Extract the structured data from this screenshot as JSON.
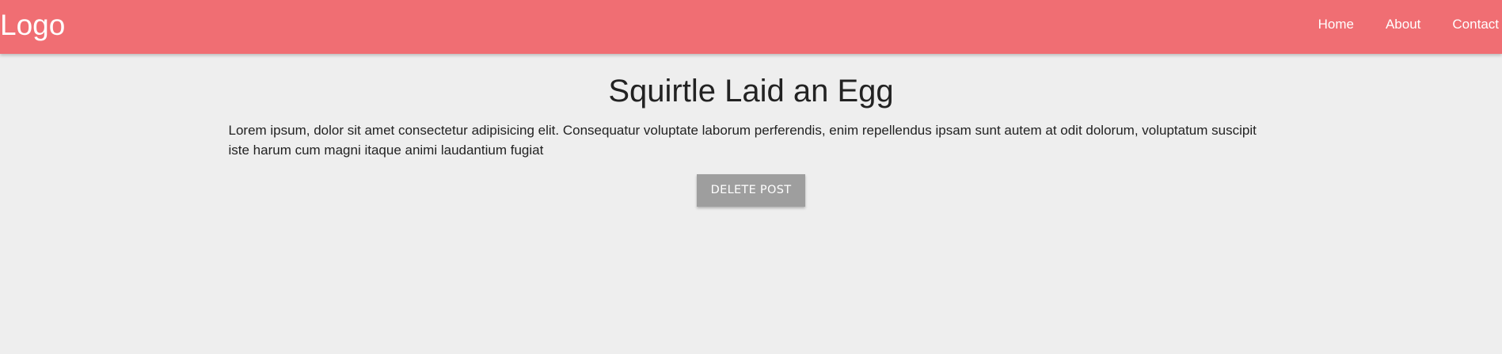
{
  "navbar": {
    "logo": "Logo",
    "links": [
      {
        "label": "Home"
      },
      {
        "label": "About"
      },
      {
        "label": "Contact"
      }
    ],
    "background_color": "#f06e73"
  },
  "post": {
    "title": "Squirtle Laid an Egg",
    "body": "Lorem ipsum, dolor sit amet consectetur adipisicing elit. Consequatur voluptate laborum perferendis, enim repellendus ipsam sunt autem at odit dolorum, voluptatum suscipit iste harum cum magni itaque animi laudantium fugiat",
    "delete_label": "DELETE POST"
  },
  "colors": {
    "page_background": "#eeeeee",
    "button_background": "#9e9e9e"
  }
}
